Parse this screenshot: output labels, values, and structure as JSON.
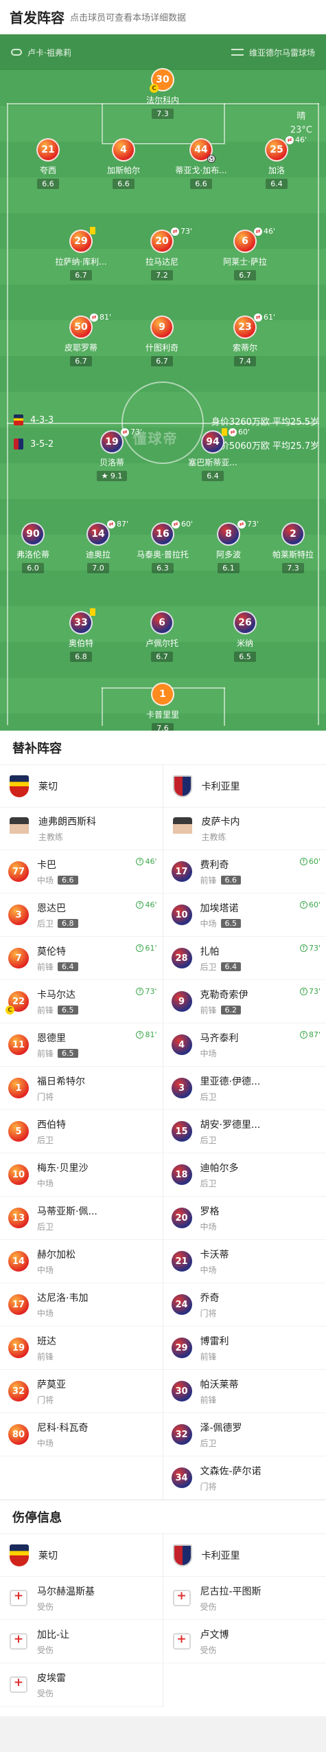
{
  "header": {
    "title": "首发阵容",
    "subtitle": "点击球员可查看本场详细数据"
  },
  "pitch": {
    "referee": "卢卡·祖弗莉",
    "stadium": "维亚德尔马雷球场",
    "weather": "晴",
    "temperature": "23°C",
    "watermark": "懂球帝",
    "lecce_formation": "4-3-3",
    "lecce_info": "身价3260万欧  平均25.5岁",
    "cagliari_formation": "3-5-2",
    "cagliari_info": "身价5060万欧  平均25.7岁"
  },
  "lecce_xi": [
    {
      "num": "30",
      "name": "法尔科内",
      "rating": "7.3",
      "captain": true
    },
    {
      "num": "21",
      "name": "夸西",
      "rating": "6.6"
    },
    {
      "num": "4",
      "name": "加斯帕尔",
      "rating": "6.6"
    },
    {
      "num": "44",
      "name": "蒂亚戈·加布...",
      "rating": "6.6",
      "goal": true
    },
    {
      "num": "25",
      "name": "加洛",
      "rating": "6.4",
      "sub": "46'"
    },
    {
      "num": "29",
      "name": "拉萨纳·库利...",
      "rating": "6.7",
      "yellow": true
    },
    {
      "num": "20",
      "name": "拉马达尼",
      "rating": "7.2",
      "sub": "73'"
    },
    {
      "num": "6",
      "name": "阿莱士·萨拉",
      "rating": "6.7",
      "sub": "46'"
    },
    {
      "num": "50",
      "name": "皮耶罗蒂",
      "rating": "6.7",
      "sub": "81'"
    },
    {
      "num": "9",
      "name": "什图利奇",
      "rating": "6.7"
    },
    {
      "num": "23",
      "name": "索蒂尔",
      "rating": "7.4",
      "sub": "61'"
    }
  ],
  "cagliari_xi": [
    {
      "num": "19",
      "name": "贝洛蒂",
      "rating": "9.1",
      "sub": "73'",
      "star": true
    },
    {
      "num": "94",
      "name": "塞巴斯蒂亚...",
      "rating": "6.4",
      "sub": "60'",
      "yellow": true
    },
    {
      "num": "90",
      "name": "弗洛伦蒂",
      "rating": "6.0"
    },
    {
      "num": "14",
      "name": "迪奥拉",
      "rating": "7.0",
      "sub": "87'"
    },
    {
      "num": "16",
      "name": "马泰奥·普拉托",
      "rating": "6.3",
      "sub": "60'"
    },
    {
      "num": "8",
      "name": "阿多波",
      "rating": "6.1",
      "sub": "73'"
    },
    {
      "num": "2",
      "name": "帕莱斯特拉",
      "rating": "7.3"
    },
    {
      "num": "33",
      "name": "奥伯特",
      "rating": "6.8",
      "yellow": true
    },
    {
      "num": "6",
      "name": "卢佩尔托",
      "rating": "6.7"
    },
    {
      "num": "26",
      "name": "米纳",
      "rating": "6.5"
    },
    {
      "num": "1",
      "name": "卡普里里",
      "rating": "7.6"
    }
  ],
  "subs": {
    "title": "替补阵容",
    "home_team": "莱切",
    "away_team": "卡利亚里",
    "home_coach": {
      "name": "迪弗朗西斯科",
      "role": "主教练"
    },
    "away_coach": {
      "name": "皮萨卡内",
      "role": "主教练"
    },
    "home": [
      {
        "num": "77",
        "name": "卡巴",
        "pos": "中场",
        "rating": "6.6",
        "in": "46'"
      },
      {
        "num": "3",
        "name": "恩达巴",
        "pos": "后卫",
        "rating": "6.8",
        "in": "46'"
      },
      {
        "num": "7",
        "name": "莫伦特",
        "pos": "前锋",
        "rating": "6.4",
        "in": "61'"
      },
      {
        "num": "22",
        "name": "卡马尔达",
        "pos": "前锋",
        "rating": "6.5",
        "in": "73'",
        "captain": true
      },
      {
        "num": "11",
        "name": "恩德里",
        "pos": "前锋",
        "rating": "6.5",
        "in": "81'"
      },
      {
        "num": "1",
        "name": "福日希特尔",
        "pos": "门将"
      },
      {
        "num": "5",
        "name": "西伯特",
        "pos": "后卫"
      },
      {
        "num": "10",
        "name": "梅东·贝里沙",
        "pos": "中场"
      },
      {
        "num": "13",
        "name": "马蒂亚斯·佩...",
        "pos": "后卫"
      },
      {
        "num": "14",
        "name": "赫尔加松",
        "pos": "中场"
      },
      {
        "num": "17",
        "name": "达尼洛·韦加",
        "pos": "中场"
      },
      {
        "num": "19",
        "name": "班达",
        "pos": "前锋"
      },
      {
        "num": "32",
        "name": "萨莫亚",
        "pos": "门将"
      },
      {
        "num": "80",
        "name": "尼科·科瓦奇",
        "pos": "中场"
      }
    ],
    "away": [
      {
        "num": "17",
        "name": "费利奇",
        "pos": "前锋",
        "rating": "6.6",
        "in": "60'"
      },
      {
        "num": "10",
        "name": "加埃塔诺",
        "pos": "中场",
        "rating": "6.5",
        "in": "60'"
      },
      {
        "num": "28",
        "name": "扎帕",
        "pos": "后卫",
        "rating": "6.4",
        "in": "73'"
      },
      {
        "num": "9",
        "name": "克勒奇索伊",
        "pos": "前锋",
        "rating": "6.2",
        "in": "73'"
      },
      {
        "num": "4",
        "name": "马齐泰利",
        "pos": "中场",
        "in": "87'"
      },
      {
        "num": "3",
        "name": "里亚德·伊德...",
        "pos": "后卫"
      },
      {
        "num": "15",
        "name": "胡安·罗德里...",
        "pos": "后卫"
      },
      {
        "num": "18",
        "name": "迪帕尔多",
        "pos": "后卫"
      },
      {
        "num": "20",
        "name": "罗格",
        "pos": "中场"
      },
      {
        "num": "21",
        "name": "卡沃蒂",
        "pos": "中场"
      },
      {
        "num": "24",
        "name": "乔奇",
        "pos": "门将"
      },
      {
        "num": "29",
        "name": "博雷利",
        "pos": "前锋"
      },
      {
        "num": "30",
        "name": "帕沃莱蒂",
        "pos": "前锋"
      },
      {
        "num": "32",
        "name": "泽-佩德罗",
        "pos": "后卫"
      },
      {
        "num": "34",
        "name": "文森佐-萨尔诺",
        "pos": "门将"
      }
    ]
  },
  "injuries": {
    "title": "伤停信息",
    "home_team": "莱切",
    "away_team": "卡利亚里",
    "home": [
      {
        "name": "马尔赫温斯基",
        "status": "受伤"
      },
      {
        "name": "加比-让",
        "status": "受伤"
      },
      {
        "name": "皮埃雷",
        "status": "受伤"
      }
    ],
    "away": [
      {
        "name": "尼古拉-平图斯",
        "status": "受伤"
      },
      {
        "name": "卢文博",
        "status": "受伤"
      }
    ]
  },
  "colors": {
    "pitch": "#4ea65a",
    "lecce": "#e02020",
    "cagliari": "#2a3080",
    "goalkeeper": "#ff8a1e",
    "sub_in": "#3aa64a"
  }
}
